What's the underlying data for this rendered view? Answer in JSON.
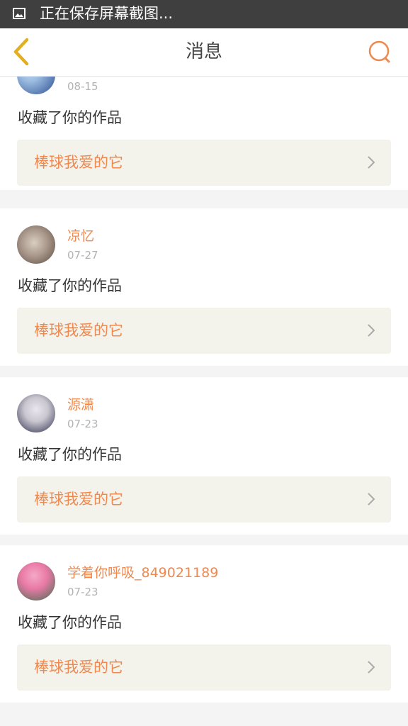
{
  "status_bar": {
    "text": "正在保存屏幕截图..."
  },
  "header": {
    "title": "消息"
  },
  "notifications": [
    {
      "user": "",
      "date": "08-15",
      "action": "收藏了你的作品",
      "work_title": "棒球我爱的它",
      "avatar_colors": [
        "#9bbbe0",
        "#2d4f92"
      ]
    },
    {
      "user": "凉忆",
      "date": "07-27",
      "action": "收藏了你的作品",
      "work_title": "棒球我爱的它",
      "avatar_colors": [
        "#d8cfbf",
        "#5b4a3e"
      ]
    },
    {
      "user": "源潇",
      "date": "07-23",
      "action": "收藏了你的作品",
      "work_title": "棒球我爱的它",
      "avatar_colors": [
        "#c9c6cf",
        "#2c2f4d"
      ]
    },
    {
      "user": "学着你呼吸_849021189",
      "date": "07-23",
      "action": "收藏了你的作品",
      "work_title": "棒球我爱的它",
      "avatar_colors": [
        "#e97aa5",
        "#3f6e4f"
      ]
    }
  ],
  "colors": {
    "accent": "#f0894f",
    "back_arrow": "#e3ae1f",
    "work_bg": "#f3f3ec",
    "status_bar": "#3f3f3f"
  }
}
